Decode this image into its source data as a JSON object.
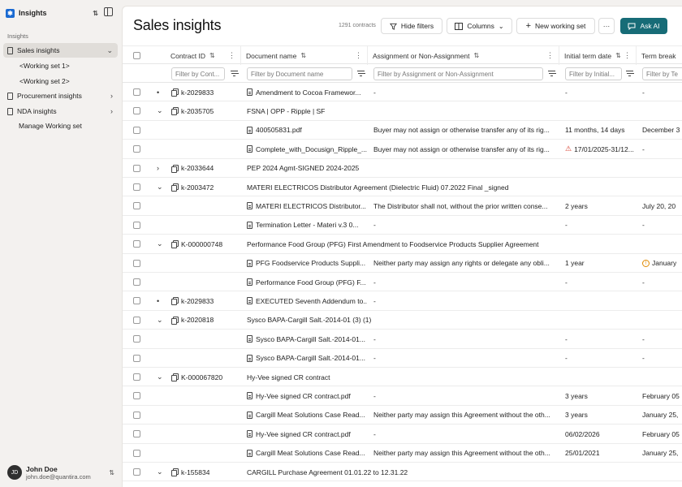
{
  "app": {
    "name": "Insights",
    "logo_glyph": "✱",
    "switch_icon": "⇅",
    "accent": "#176c77"
  },
  "sidebar": {
    "section_label": "Insights",
    "items": [
      {
        "label": "Sales insights",
        "active": true,
        "chevron": "⌄"
      },
      {
        "label": "<Working set 1>"
      },
      {
        "label": "<Working set 2>"
      },
      {
        "label": "Procurement insights",
        "chevron": "›"
      },
      {
        "label": "NDA insights",
        "chevron": "›"
      },
      {
        "label": "Manage Working set"
      }
    ],
    "user": {
      "initials": "JD",
      "name": "John Doe",
      "email": "john.doe@quantira.com"
    }
  },
  "main": {
    "title": "Sales insights",
    "count": "1291 contracts",
    "buttons": {
      "hide_filters": "Hide filters",
      "columns": "Columns",
      "new_working_set": "New working set",
      "more": "···",
      "ask_ai": "Ask AI"
    }
  },
  "table": {
    "headers": [
      "Contract ID",
      "Document name",
      "Assignment or Non-Assignment",
      "Initial term date",
      "Term break"
    ],
    "filter_placeholders": [
      "Filter by Cont...",
      "Filter by Document name",
      "Filter by Assignment or Non-Assignment",
      "Filter by Initial...",
      "Filter by Te"
    ],
    "rows": [
      {
        "exp": "•",
        "id": "k-2029833",
        "doc": "Amendment to Cocoa Framewor...",
        "doc_icon": true,
        "assign": "-",
        "term": "-",
        "brk": "-"
      },
      {
        "exp": "⌄",
        "id": "k-2035705",
        "doc": "FSNA | OPP - Ripple | SF",
        "doc_icon": false,
        "assign": "",
        "term": "",
        "brk": ""
      },
      {
        "exp": "",
        "id": "",
        "doc": "400505831.pdf",
        "doc_icon": true,
        "assign": "Buyer may not assign or otherwise transfer any of its rig...",
        "term": "11 months, 14 days",
        "brk": "December 3"
      },
      {
        "exp": "",
        "id": "",
        "doc": "Complete_with_Docusign_Ripple_...",
        "doc_icon": true,
        "assign": "Buyer may not assign or otherwise transfer any of its rig...",
        "term": "17/01/2025-31/12...",
        "term_warn": true,
        "brk": "-"
      },
      {
        "exp": "›",
        "id": "k-2033644",
        "doc": "PEP 2024 Agmt-SIGNED 2024-2025",
        "doc_icon": false,
        "assign": "",
        "term": "",
        "brk": ""
      },
      {
        "exp": "⌄",
        "id": "k-2003472",
        "doc": "MATERI ELECTRICOS Distributor Agreement (Dielectric Fluid) 07.2022 Final _signed",
        "doc_icon": false,
        "assign": "",
        "term": "",
        "brk": ""
      },
      {
        "exp": "",
        "id": "",
        "doc": "MATERI ELECTRICOS Distributor...",
        "doc_icon": true,
        "assign": "The Distributor shall not, without the prior written conse...",
        "term": "2 years",
        "brk": "July 20, 20"
      },
      {
        "exp": "",
        "id": "",
        "doc": "Termination Letter - Materi v.3 0...",
        "doc_icon": true,
        "assign": "-",
        "term": "-",
        "brk": "-"
      },
      {
        "exp": "⌄",
        "id": "K-000000748",
        "doc": "Performance Food Group (PFG) First Amendment to Foodservice Products Supplier Agreement",
        "doc_icon": false,
        "assign": "",
        "term": "",
        "brk": ""
      },
      {
        "exp": "",
        "id": "",
        "doc": "PFG Foodservice Products Suppli...",
        "doc_icon": true,
        "assign": "Neither party may assign any rights or delegate any obli...",
        "term": "1 year",
        "brk": "January",
        "brk_info": true
      },
      {
        "exp": "",
        "id": "",
        "doc": "Performance Food Group (PFG) F...",
        "doc_icon": true,
        "assign": "-",
        "term": "-",
        "brk": "-"
      },
      {
        "exp": "•",
        "id": "k-2029833",
        "doc": "EXECUTED Seventh Addendum to...",
        "doc_icon": true,
        "assign": "-",
        "term": "",
        "brk": ""
      },
      {
        "exp": "⌄",
        "id": "k-2020818",
        "doc": "Sysco BAPA-Cargill Salt.-2014-01 (3) (1)",
        "doc_icon": false,
        "assign": "",
        "term": "",
        "brk": ""
      },
      {
        "exp": "",
        "id": "",
        "doc": "Sysco BAPA-Cargill Salt.-2014-01...",
        "doc_icon": true,
        "assign": "-",
        "term": "-",
        "brk": "-"
      },
      {
        "exp": "",
        "id": "",
        "doc": "Sysco BAPA-Cargill Salt.-2014-01...",
        "doc_icon": true,
        "assign": "-",
        "term": "-",
        "brk": "-"
      },
      {
        "exp": "⌄",
        "id": "K-000067820",
        "doc": "Hy-Vee signed CR contract",
        "doc_icon": false,
        "assign": "",
        "term": "",
        "brk": ""
      },
      {
        "exp": "",
        "id": "",
        "doc": "Hy-Vee signed CR contract.pdf",
        "doc_icon": true,
        "assign": "-",
        "term": "3 years",
        "brk": "February 05"
      },
      {
        "exp": "",
        "id": "",
        "doc": "Cargill Meat Solutions Case Read...",
        "doc_icon": true,
        "assign": "Neither party may assign this Agreement without the oth...",
        "term": "3 years",
        "brk": "January 25,"
      },
      {
        "exp": "",
        "id": "",
        "doc": "Hy-Vee signed CR contract.pdf",
        "doc_icon": true,
        "assign": "-",
        "term": "06/02/2026",
        "brk": "February 05"
      },
      {
        "exp": "",
        "id": "",
        "doc": "Cargill Meat Solutions Case Read...",
        "doc_icon": true,
        "assign": "Neither party may assign this Agreement without the oth...",
        "term": "25/01/2021",
        "brk": "January 25,"
      },
      {
        "exp": "⌄",
        "id": "k-155834",
        "doc": "CARGILL Purchase Agreement 01.01.22 to 12.31.22",
        "doc_icon": false,
        "assign": "",
        "term": "",
        "brk": ""
      }
    ]
  }
}
